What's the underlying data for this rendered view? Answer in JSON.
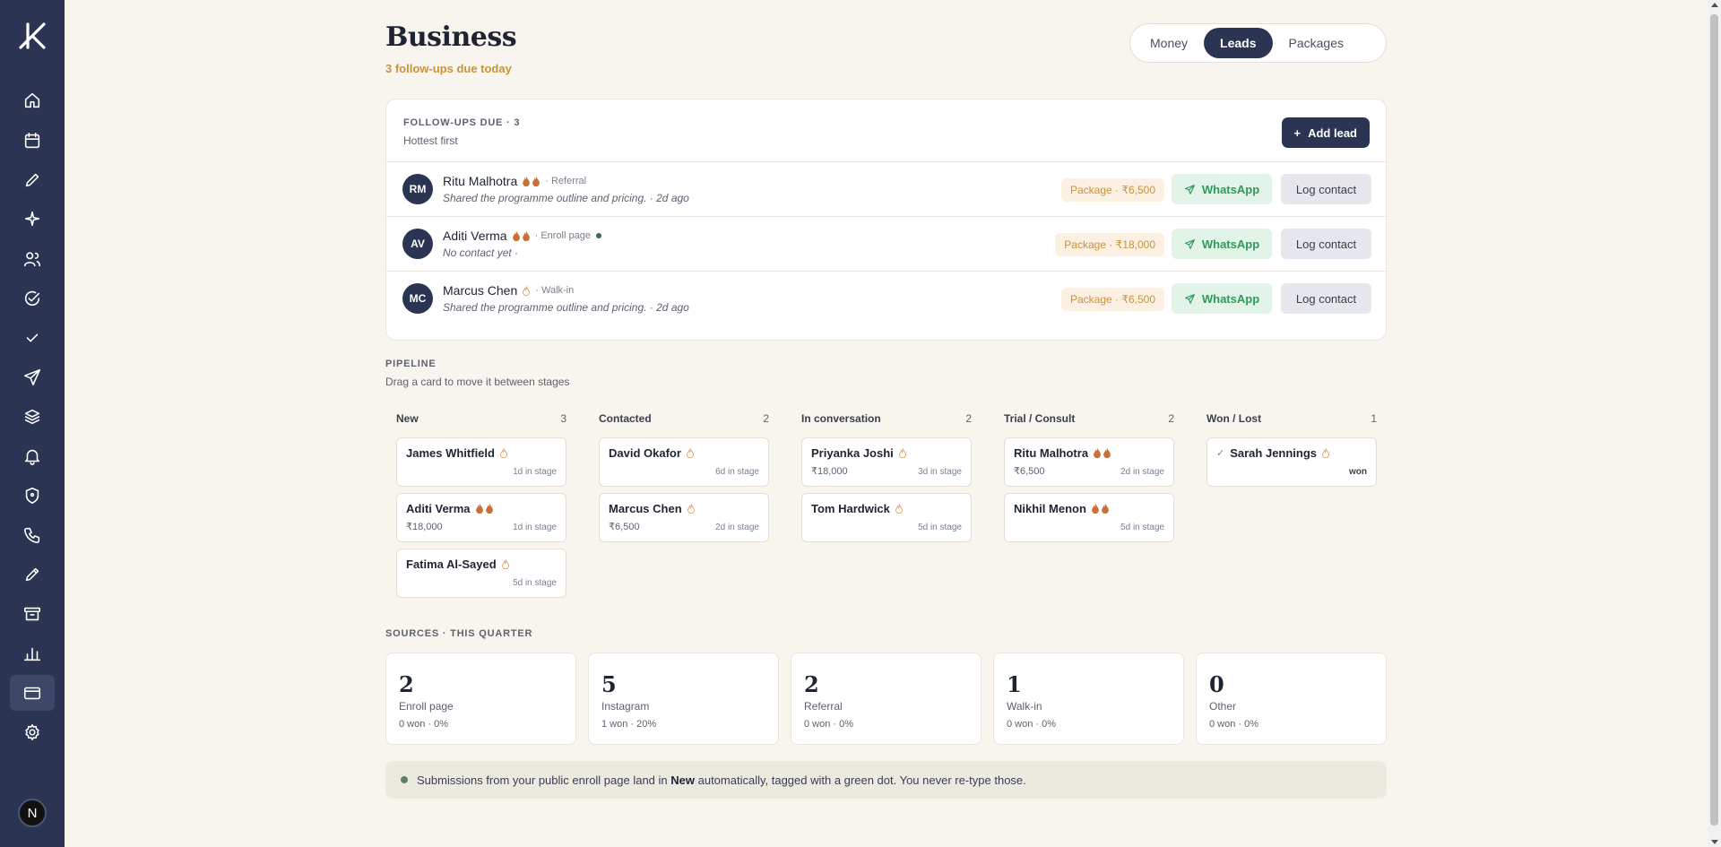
{
  "app": {
    "title": "Business",
    "subtitle": "3 follow-ups due today"
  },
  "colors": {
    "navy": "#2b3553",
    "amber": "#c8923e",
    "green": "#2e9a5a",
    "background": "#f8f4ee"
  },
  "sidebar": {
    "icons": [
      "home-icon",
      "calendar-icon",
      "pencil-icon",
      "sparkle-icon",
      "users-icon",
      "check-circle-icon",
      "check-icon",
      "send-icon",
      "layers-icon",
      "bell-icon",
      "shield-icon",
      "phone-icon",
      "edit-icon",
      "archive-icon",
      "bar-chart-icon",
      "card-icon",
      "gear-icon"
    ],
    "active": "card-icon",
    "avatar_initial": "N"
  },
  "tabs": {
    "money": "Money",
    "leads": "Leads",
    "packages": "Packages",
    "active": "Leads"
  },
  "followups": {
    "heading": "FOLLOW-UPS DUE · 3",
    "sub": "Hottest first",
    "add_label": "Add lead",
    "whatsapp_label": "WhatsApp",
    "log_label": "Log contact",
    "rows": [
      {
        "initials": "RM",
        "name": "Ritu Malhotra",
        "heat": 2,
        "source": "· Referral",
        "new_dot": false,
        "note": "Shared the programme outline and pricing. · 2d ago",
        "package": "Package · ₹6,500"
      },
      {
        "initials": "AV",
        "name": "Aditi Verma",
        "heat": 2,
        "source": "· Enroll page",
        "new_dot": true,
        "note": "No contact yet ·",
        "package": "Package · ₹18,000"
      },
      {
        "initials": "MC",
        "name": "Marcus Chen",
        "heat": 1,
        "source": "· Walk-in",
        "new_dot": false,
        "note": "Shared the programme outline and pricing. · 2d ago",
        "package": "Package · ₹6,500"
      }
    ]
  },
  "pipeline": {
    "heading": "PIPELINE",
    "sub": "Drag a card to move it between stages",
    "columns": [
      {
        "title": "New",
        "count": "3",
        "cards": [
          {
            "name": "James Whitfield",
            "heat": 1,
            "value": "",
            "stage": "1d in stage"
          },
          {
            "name": "Aditi Verma",
            "heat": 2,
            "value": "₹18,000",
            "stage": "1d in stage"
          },
          {
            "name": "Fatima Al-Sayed",
            "heat": 1,
            "value": "",
            "stage": "5d in stage"
          }
        ]
      },
      {
        "title": "Contacted",
        "count": "2",
        "cards": [
          {
            "name": "David Okafor",
            "heat": 1,
            "value": "",
            "stage": "6d in stage"
          },
          {
            "name": "Marcus Chen",
            "heat": 1,
            "value": "₹6,500",
            "stage": "2d in stage"
          }
        ]
      },
      {
        "title": "In conversation",
        "count": "2",
        "cards": [
          {
            "name": "Priyanka Joshi",
            "heat": 1,
            "value": "₹18,000",
            "stage": "3d in stage"
          },
          {
            "name": "Tom Hardwick",
            "heat": 1,
            "value": "",
            "stage": "5d in stage"
          }
        ]
      },
      {
        "title": "Trial / Consult",
        "count": "2",
        "cards": [
          {
            "name": "Ritu Malhotra",
            "heat": 2,
            "value": "₹6,500",
            "stage": "2d in stage"
          },
          {
            "name": "Nikhil Menon",
            "heat": 2,
            "value": "",
            "stage": "5d in stage"
          }
        ]
      },
      {
        "title": "Won / Lost",
        "count": "1",
        "cards": [
          {
            "name": "Sarah Jennings",
            "heat": 1,
            "value": "",
            "stage": "won",
            "won": true
          }
        ]
      }
    ]
  },
  "sources": {
    "heading": "SOURCES · THIS QUARTER",
    "items": [
      {
        "count": "2",
        "label": "Enroll page",
        "stat": "0 won · 0%"
      },
      {
        "count": "5",
        "label": "Instagram",
        "stat": "1 won · 20%"
      },
      {
        "count": "2",
        "label": "Referral",
        "stat": "0 won · 0%"
      },
      {
        "count": "1",
        "label": "Walk-in",
        "stat": "0 won · 0%"
      },
      {
        "count": "0",
        "label": "Other",
        "stat": "0 won · 0%"
      }
    ]
  },
  "note": {
    "before": "Submissions from your public enroll page land in ",
    "bold": "New",
    "after": " automatically, tagged with a green dot. You never re-type those."
  }
}
